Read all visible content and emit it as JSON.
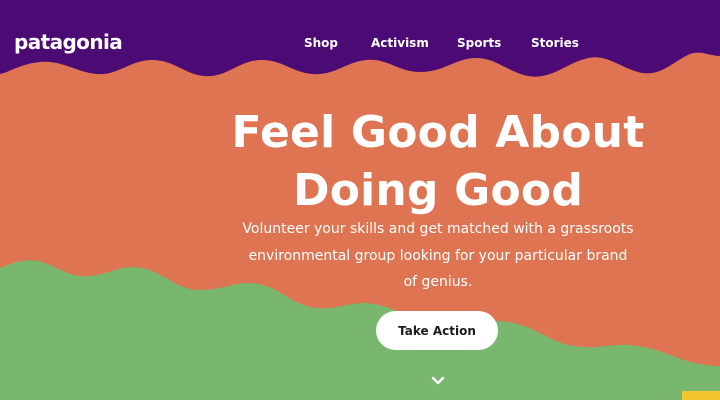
{
  "brand": {
    "logo_text": "patagonia"
  },
  "nav": {
    "items": [
      "Shop",
      "Activism",
      "Sports",
      "Stories"
    ]
  },
  "hero": {
    "title_line1": "Feel Good About",
    "title_line2": "Doing Good",
    "subtitle": "Volunteer your skills and get matched with a grassroots environmental group looking for your particular brand of genius.",
    "cta_label": "Take Action",
    "scroll_icon": "chevron-down-icon"
  },
  "colors": {
    "header_purple": "#4c0a74",
    "hero_orange": "#de7452",
    "wave_green": "#79b76f",
    "accent_yellow": "#f4c431",
    "text_white": "#ffffff",
    "button_text": "#1c1c1c"
  }
}
